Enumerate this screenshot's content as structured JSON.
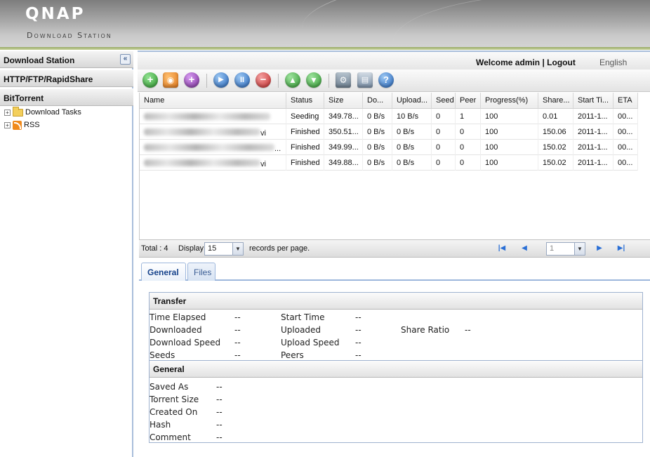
{
  "header": {
    "logo": "QNAP",
    "subtitle": "Download Station"
  },
  "sidebar": {
    "title": "Download Station",
    "collapse_glyph": "«",
    "sections": [
      {
        "label": "HTTP/FTP/RapidShare"
      },
      {
        "label": "BitTorrent"
      }
    ],
    "tree": [
      {
        "label": "Download Tasks",
        "icon": "folder-icon"
      },
      {
        "label": "RSS",
        "icon": "rss-icon"
      }
    ]
  },
  "topbar": {
    "welcome": "Welcome admin |",
    "logout": "Logout",
    "language": "English"
  },
  "toolbar": {
    "buttons": [
      {
        "name": "add-task-icon",
        "color": "#3aa53a"
      },
      {
        "name": "add-rss-icon",
        "color": "#f08a1c"
      },
      {
        "name": "add-purple-icon",
        "color": "#8b3fa8"
      },
      {
        "name": "start-icon",
        "color": "#2f7ad3"
      },
      {
        "name": "pause-icon",
        "color": "#2f7ad3"
      },
      {
        "name": "remove-icon",
        "color": "#d63a3a"
      },
      {
        "name": "move-up-icon",
        "color": "#3aa53a"
      },
      {
        "name": "move-down-icon",
        "color": "#3aa53a"
      },
      {
        "name": "settings-icon",
        "color": "#7a8a9a"
      },
      {
        "name": "config-icon",
        "color": "#5a7aa0"
      },
      {
        "name": "help-icon",
        "color": "#2f7ad3"
      }
    ]
  },
  "grid": {
    "columns": [
      "Name",
      "Status",
      "Size",
      "Do...",
      "Upload...",
      "Seed",
      "Peer",
      "Progress(%)",
      "Share...",
      "Start Ti...",
      "ETA"
    ],
    "rows": [
      {
        "name_suffix": "",
        "status": "Seeding",
        "size": "349.78...",
        "down": "0 B/s",
        "up": "10 B/s",
        "seed": "0",
        "peer": "1",
        "progress": "100",
        "share": "0.01",
        "start": "2011-1...",
        "eta": "00..."
      },
      {
        "name_suffix": "vi",
        "status": "Finished",
        "size": "350.51...",
        "down": "0 B/s",
        "up": "0 B/s",
        "seed": "0",
        "peer": "0",
        "progress": "100",
        "share": "150.06",
        "start": "2011-1...",
        "eta": "00..."
      },
      {
        "name_suffix": "...",
        "status": "Finished",
        "size": "349.99...",
        "down": "0 B/s",
        "up": "0 B/s",
        "seed": "0",
        "peer": "0",
        "progress": "100",
        "share": "150.02",
        "start": "2011-1...",
        "eta": "00..."
      },
      {
        "name_suffix": "vi",
        "status": "Finished",
        "size": "349.88...",
        "down": "0 B/s",
        "up": "0 B/s",
        "seed": "0",
        "peer": "0",
        "progress": "100",
        "share": "150.02",
        "start": "2011-1...",
        "eta": "00..."
      }
    ]
  },
  "pager": {
    "total": "Total : 4",
    "display_label": "Display",
    "per_page": "15",
    "per_page_suffix": "records per page.",
    "page": "1"
  },
  "tabs": [
    {
      "label": "General"
    },
    {
      "label": "Files"
    }
  ],
  "transfer": {
    "title": "Transfer",
    "fields": [
      {
        "label": "Time Elapsed",
        "value": "--"
      },
      {
        "label": "Start Time",
        "value": "--"
      },
      {
        "label": "Downloaded",
        "value": "--"
      },
      {
        "label": "Uploaded",
        "value": "--"
      },
      {
        "label": "Share Ratio",
        "value": "--"
      },
      {
        "label": "Download Speed",
        "value": "--"
      },
      {
        "label": "Upload Speed",
        "value": "--"
      },
      {
        "label": "Seeds",
        "value": "--"
      },
      {
        "label": "Peers",
        "value": "--"
      }
    ]
  },
  "general": {
    "title": "General",
    "fields": [
      {
        "label": "Saved As",
        "value": "--"
      },
      {
        "label": "Torrent Size",
        "value": "--"
      },
      {
        "label": "Created On",
        "value": "--"
      },
      {
        "label": "Hash",
        "value": "--"
      },
      {
        "label": "Comment",
        "value": "--"
      }
    ]
  }
}
